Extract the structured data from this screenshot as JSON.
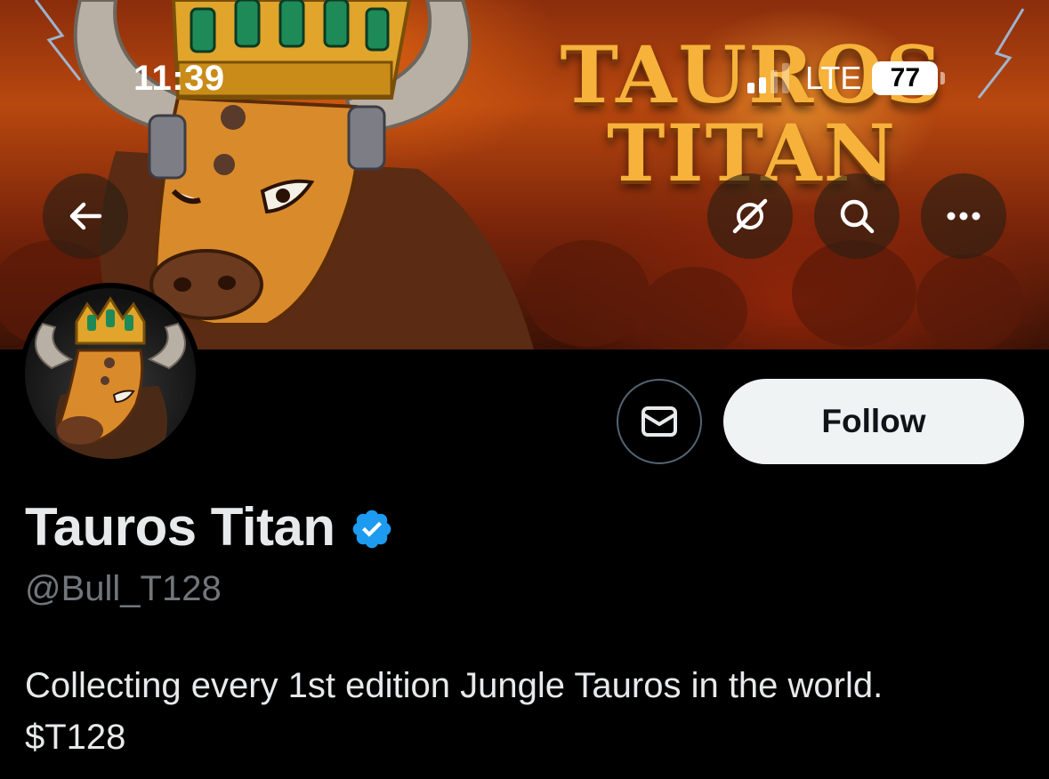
{
  "status_bar": {
    "time": "11:39",
    "network": "LTE",
    "battery": "77"
  },
  "banner": {
    "title_line1": "TAUROS",
    "title_line2": "TITAN"
  },
  "header_icons": [
    "back-arrow-icon",
    "grok-icon",
    "search-icon",
    "more-icon"
  ],
  "actions": {
    "follow_label": "Follow",
    "message_icon": "mail-icon"
  },
  "profile": {
    "display_name": "Tauros Titan",
    "handle": "@Bull_T128",
    "bio_line1": "Collecting every 1st edition Jungle Tauros in the world.",
    "bio_line2": "$T128"
  },
  "colors": {
    "verified": "#1d9bf0",
    "follow_bg": "#eff3f4",
    "handle": "#71767b",
    "background": "#000000"
  }
}
